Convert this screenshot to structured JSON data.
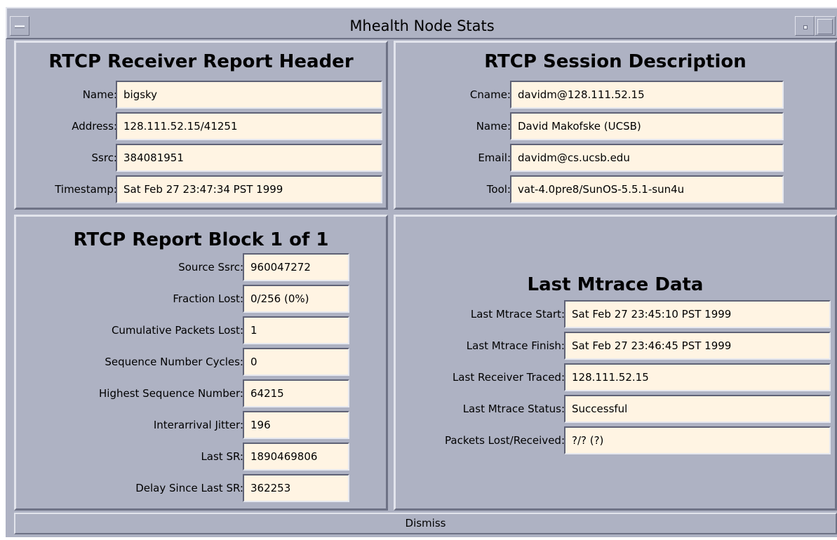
{
  "window": {
    "title": "Mhealth Node Stats"
  },
  "receiver_header": {
    "title": "RTCP Receiver Report Header",
    "fields": [
      {
        "label": "Name:",
        "value": "bigsky"
      },
      {
        "label": "Address:",
        "value": "128.111.52.15/41251"
      },
      {
        "label": "Ssrc:",
        "value": "384081951"
      },
      {
        "label": "Timestamp:",
        "value": "Sat Feb 27 23:47:34 PST 1999"
      }
    ]
  },
  "session_description": {
    "title": "RTCP Session Description",
    "fields": [
      {
        "label": "Cname:",
        "value": "davidm@128.111.52.15"
      },
      {
        "label": "Name:",
        "value": "David Makofske (UCSB)"
      },
      {
        "label": "Email:",
        "value": "davidm@cs.ucsb.edu"
      },
      {
        "label": "Tool:",
        "value": "vat-4.0pre8/SunOS-5.5.1-sun4u"
      }
    ]
  },
  "report_block": {
    "title": "RTCP Report Block 1 of 1",
    "fields": [
      {
        "label": "Source Ssrc:",
        "value": "960047272"
      },
      {
        "label": "Fraction Lost:",
        "value": "0/256 (0%)"
      },
      {
        "label": "Cumulative Packets Lost:",
        "value": "1"
      },
      {
        "label": "Sequence Number Cycles:",
        "value": "0"
      },
      {
        "label": "Highest Sequence Number:",
        "value": "64215"
      },
      {
        "label": "Interarrival Jitter:",
        "value": "196"
      },
      {
        "label": "Last SR:",
        "value": "1890469806"
      },
      {
        "label": "Delay Since Last SR:",
        "value": "362253"
      }
    ]
  },
  "mtrace": {
    "title": "Last Mtrace Data",
    "fields": [
      {
        "label": "Last Mtrace Start:",
        "value": "Sat Feb 27 23:45:10 PST 1999"
      },
      {
        "label": "Last Mtrace Finish:",
        "value": "Sat Feb 27 23:46:45 PST 1999"
      },
      {
        "label": "Last Receiver Traced:",
        "value": "128.111.52.15"
      },
      {
        "label": "Last Mtrace Status:",
        "value": "Successful"
      },
      {
        "label": "Packets Lost/Received:",
        "value": "?/? (?)"
      }
    ]
  },
  "buttons": {
    "dismiss": "Dismiss"
  }
}
